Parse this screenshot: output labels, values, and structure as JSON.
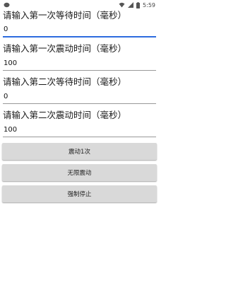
{
  "status_bar": {
    "time": "5:59",
    "icons": [
      "notification-dot-icon",
      "wifi-icon",
      "signal-icon",
      "battery-icon"
    ]
  },
  "fields": [
    {
      "label": "请输入第一次等待时间（毫秒）",
      "value": "0",
      "focused": true
    },
    {
      "label": "请输入第一次震动时间（毫秒）",
      "value": "100",
      "focused": false
    },
    {
      "label": "请输入第二次等待时间（毫秒）",
      "value": "0",
      "focused": false
    },
    {
      "label": "请输入第二次震动时间（毫秒）",
      "value": "100",
      "focused": false
    }
  ],
  "buttons": {
    "vibrate_once": "震动1次",
    "vibrate_infinite": "无限震动",
    "force_stop": "强制停止"
  },
  "colors": {
    "accent": "#2d6cdf",
    "button_bg": "#d9d9d9"
  }
}
